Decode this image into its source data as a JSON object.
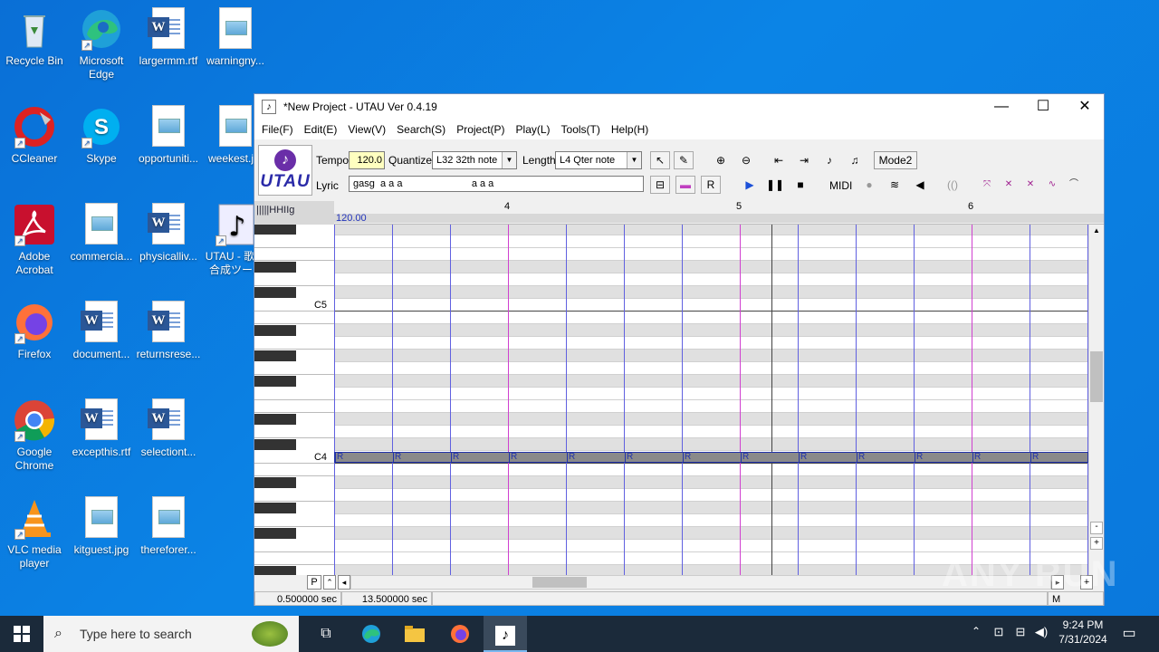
{
  "desktop": {
    "icons": [
      {
        "label": "Recycle Bin",
        "icon": "recycle-bin-icon"
      },
      {
        "label": "Microsoft Edge",
        "icon": "edge-icon"
      },
      {
        "label": "largermm.rtf",
        "icon": "word-doc-icon"
      },
      {
        "label": "warningny...",
        "icon": "image-file-icon"
      },
      {
        "label": "CCleaner",
        "icon": "ccleaner-icon"
      },
      {
        "label": "Skype",
        "icon": "skype-icon"
      },
      {
        "label": "opportuniti...",
        "icon": "image-file-icon"
      },
      {
        "label": "weekest.j...",
        "icon": "image-file-icon"
      },
      {
        "label": "Adobe Acrobat",
        "icon": "acrobat-icon"
      },
      {
        "label": "commercia...",
        "icon": "image-file-icon"
      },
      {
        "label": "physicalliv...",
        "icon": "word-doc-icon"
      },
      {
        "label": "UTAU - 歌声合成ツー...",
        "icon": "utau-icon"
      },
      {
        "label": "Firefox",
        "icon": "firefox-icon"
      },
      {
        "label": "document...",
        "icon": "word-doc-icon"
      },
      {
        "label": "returnsrese...",
        "icon": "word-doc-icon"
      },
      {
        "label": "Google Chrome",
        "icon": "chrome-icon"
      },
      {
        "label": "excepthis.rtf",
        "icon": "word-doc-icon"
      },
      {
        "label": "selectiont...",
        "icon": "word-doc-icon"
      },
      {
        "label": "VLC media player",
        "icon": "vlc-icon"
      },
      {
        "label": "kitguest.jpg",
        "icon": "image-file-icon"
      },
      {
        "label": "thereforer...",
        "icon": "image-file-icon"
      }
    ]
  },
  "window": {
    "title": "*New Project - UTAU Ver 0.4.19",
    "controls": {
      "minimize": "—",
      "maximize": "☐",
      "close": "✕"
    },
    "menu": [
      "File(F)",
      "Edit(E)",
      "View(V)",
      "Search(S)",
      "Project(P)",
      "Play(L)",
      "Tools(T)",
      "Help(H)"
    ],
    "toolbar": {
      "logo_text": "UTAU",
      "tempo_label": "Tempo",
      "tempo_value": "120.0",
      "quantize_label": "Quantize",
      "quantize_value": "L32 32th note",
      "length_label": "Length",
      "length_value": "L4  Qter note",
      "lyric_label": "Lyric",
      "lyric_value": "gasg  a a a                         a a a",
      "mode_button": "Mode2",
      "midi_label": "MIDI"
    },
    "editor": {
      "corner_label": "|||||HHIIg",
      "tempo_marker": "120.00",
      "bars": [
        "4",
        "5",
        "6"
      ],
      "key_labels": {
        "c5": "C5",
        "c4": "C4"
      },
      "rest_label": "R",
      "rest_count": 13
    },
    "bottom": {
      "p_button": "P",
      "time_start": "0.500000 sec",
      "time_end": "13.500000 sec",
      "m_label": "M"
    }
  },
  "taskbar": {
    "search_placeholder": "Type here to search",
    "time": "9:24 PM",
    "date": "7/31/2024"
  },
  "watermark": "ANY RUN",
  "colors": {
    "desktop": "#0a78dc",
    "rest_bar": "#8a8a8a",
    "bar_line": "#d040d0",
    "beat_line": "#6060e0"
  }
}
